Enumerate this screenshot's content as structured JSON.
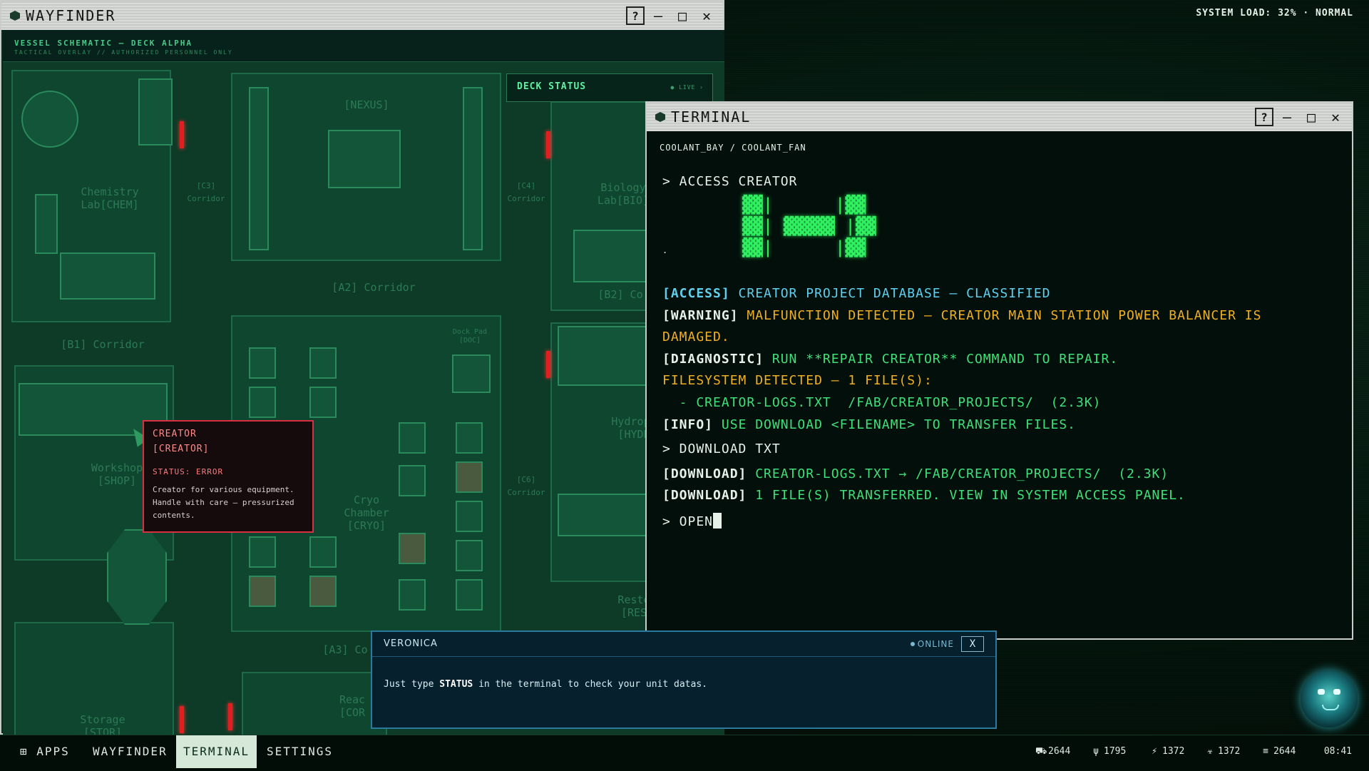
{
  "system": {
    "load_text": "SYSTEM LOAD: 32% · NORMAL"
  },
  "wayfinder": {
    "title": "WAYFINDER",
    "help_label": "?",
    "header_title": "VESSEL SCHEMATIC — DECK ALPHA",
    "header_subtitle": "TACTICAL OVERLAY // AUTHORIZED PERSONNEL ONLY",
    "deck_status": {
      "label": "DECK STATUS",
      "live": "● LIVE ›"
    },
    "rooms": {
      "nexus": "[NEXUS]",
      "chem": "Chemistry\nLab[CHEM]",
      "c3": "[C3]\nCorridor",
      "c4": "[C4]\nCorridor",
      "bio": "Biology\nLab[BIO]",
      "a2": "[A2] Corridor",
      "b1": "[B1] Corridor",
      "b2": "[B2] Co",
      "shop": "Workshop\n[SHOP]",
      "cryo": "Cryo\nChamber\n[CRYO]",
      "c6": "[C6]\nCorridor",
      "hydro": "Hydropo\n[HYDR",
      "rest": "Resto\n[RES",
      "a3": "[A3] Co",
      "core": "Reac\n[COR",
      "stor": "Storage\n[STOR]",
      "dock": "Dock Pad\n[DOC]"
    },
    "tooltip": {
      "name": "CREATOR",
      "code": "[CREATOR]",
      "status": "STATUS: ERROR",
      "description": "Creator for various equipment. Handle with care — pressurized contents."
    }
  },
  "terminal": {
    "title": "TERMINAL",
    "help_label": "?",
    "breadcrumb": "COOLANT_BAY / COOLANT_FAN",
    "cmd1": "> ACCESS CREATOR",
    "ascii": "  ▓▓|      |▓▓\n  ▓▓| ▓▓▓▓▓ |▓▓\n  ▓▓|      |▓▓",
    "dot": ".",
    "access_tag": "[ACCESS]",
    "access_text": " CREATOR PROJECT DATABASE — CLASSIFIED",
    "warning_tag": "[WARNING]",
    "warning_text": " MALFUNCTION DETECTED — CREATOR MAIN STATION POWER BALANCER IS",
    "warning_text2": "DAMAGED.",
    "diag_tag": "[DIAGNOSTIC]",
    "diag_text": " RUN **REPAIR CREATOR** COMMAND TO REPAIR.",
    "fs_line": "FILESYSTEM DETECTED — 1 FILE(S):",
    "file_line": "  - CREATOR-LOGS.TXT  /FAB/CREATOR_PROJECTS/  (2.3K)",
    "info_tag": "[INFO]",
    "info_text": " USE DOWNLOAD <FILENAME> TO TRANSFER FILES.",
    "cmd2": "> DOWNLOAD TXT",
    "dl_tag": "[DOWNLOAD]",
    "dl_text1": " CREATOR-LOGS.TXT → /FAB/CREATOR_PROJECTS/  (2.3K)",
    "dl_text2": " 1 FILE(S) TRANSFERRED. VIEW IN SYSTEM ACCESS PANEL.",
    "input_value": "> OPEN"
  },
  "chat": {
    "name": "VERONICA",
    "status": "ONLINE",
    "close": "X",
    "msg_pre": "Just type ",
    "msg_bold": "STATUS",
    "msg_post": " in the terminal to check your unit datas."
  },
  "taskbar": {
    "apps": "⊞ APPS",
    "wayfinder": "WAYFINDER",
    "terminal": "TERMINAL",
    "settings": "SETTINGS",
    "stats": [
      {
        "icon": "vehicle-icon",
        "glyph": "⛟",
        "value": "2644"
      },
      {
        "icon": "crop-icon",
        "glyph": "ψ",
        "value": "1795"
      },
      {
        "icon": "energy-icon",
        "glyph": "⚡",
        "value": "1372"
      },
      {
        "icon": "biohazard-icon",
        "glyph": "☣",
        "value": "1372"
      },
      {
        "icon": "database-icon",
        "glyph": "≡",
        "value": "2644"
      }
    ],
    "clock": "08:41"
  }
}
